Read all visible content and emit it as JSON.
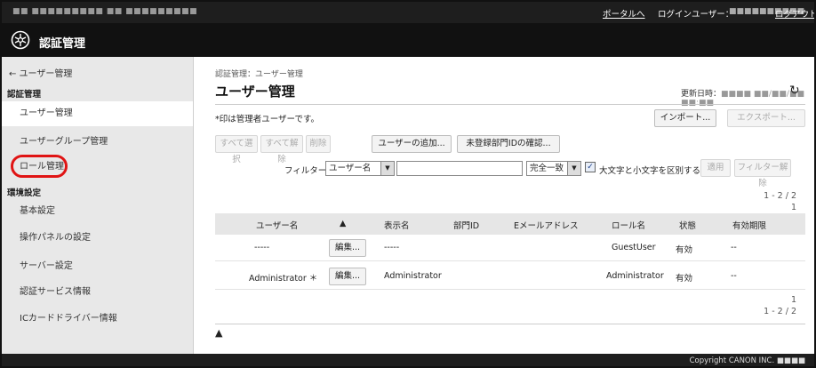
{
  "topbar": {
    "left_text": "■■ ■■■■■■■■■ ■■ ■■■■■■■■■",
    "portal_link": "ポータルへ",
    "login_user_label": "ログインユーザー：",
    "login_user_name": "■■■■■■■■■■",
    "logout_link": "ログアウト"
  },
  "app": {
    "title": "認証管理"
  },
  "sidebar": {
    "back_link": "← ユーザー管理",
    "section_auth": "認証管理",
    "auth_items": [
      "ユーザー管理",
      "ユーザーグループ管理",
      "ロール管理"
    ],
    "section_env": "環境設定",
    "env_items": [
      "基本設定",
      "操作パネルの設定",
      "サーバー設定",
      "認証サービス情報",
      "ICカードドライバー情報"
    ]
  },
  "main": {
    "breadcrumb": "認証管理：ユーザー管理",
    "title": "ユーザー管理",
    "updated_label": "更新日時：",
    "updated_value": "■■■■ ■■/■■/■■ ■■:■■",
    "note": "*印は管理者ユーザーです。",
    "import_button": "インポート...",
    "export_button": "エクスポート...",
    "select_all_button": "すべて選択",
    "deselect_all_button": "すべて解除",
    "delete_button": "削除",
    "add_user_button": "ユーザーの追加...",
    "unregistered_button": "未登録部門IDの確認...",
    "filter_label": "フィルター：",
    "filter_field_value": "ユーザー名",
    "filter_text_value": "",
    "match_value": "完全一致",
    "case_checkbox_label": "大文字と小文字を区別する",
    "apply_button": "適用",
    "clear_filter_button": "フィルター解除",
    "paging_range": "1 - 2 / 2",
    "paging_page": "1",
    "top_icon": "go-to-top-icon"
  },
  "table": {
    "columns": [
      "ユーザー名",
      "▲",
      "表示名",
      "部門ID",
      "Eメールアドレス",
      "ロール名",
      "状態",
      "有効期限"
    ],
    "edit_label": "編集...",
    "rows": [
      {
        "user": "-----",
        "display": "-----",
        "dept": "",
        "email": "",
        "role": "GuestUser",
        "status": "有効",
        "expiry": "--"
      },
      {
        "user": "Administrator ＊",
        "display": "Administrator",
        "dept": "",
        "email": "",
        "role": "Administrator",
        "status": "有効",
        "expiry": "--"
      }
    ]
  },
  "footer": {
    "copyright": "Copyright CANON INC. ■■■■"
  },
  "colors": {
    "header_bg": "#111111",
    "sidebar_bg": "#e8e8e8",
    "highlight_ring": "#e01414"
  }
}
